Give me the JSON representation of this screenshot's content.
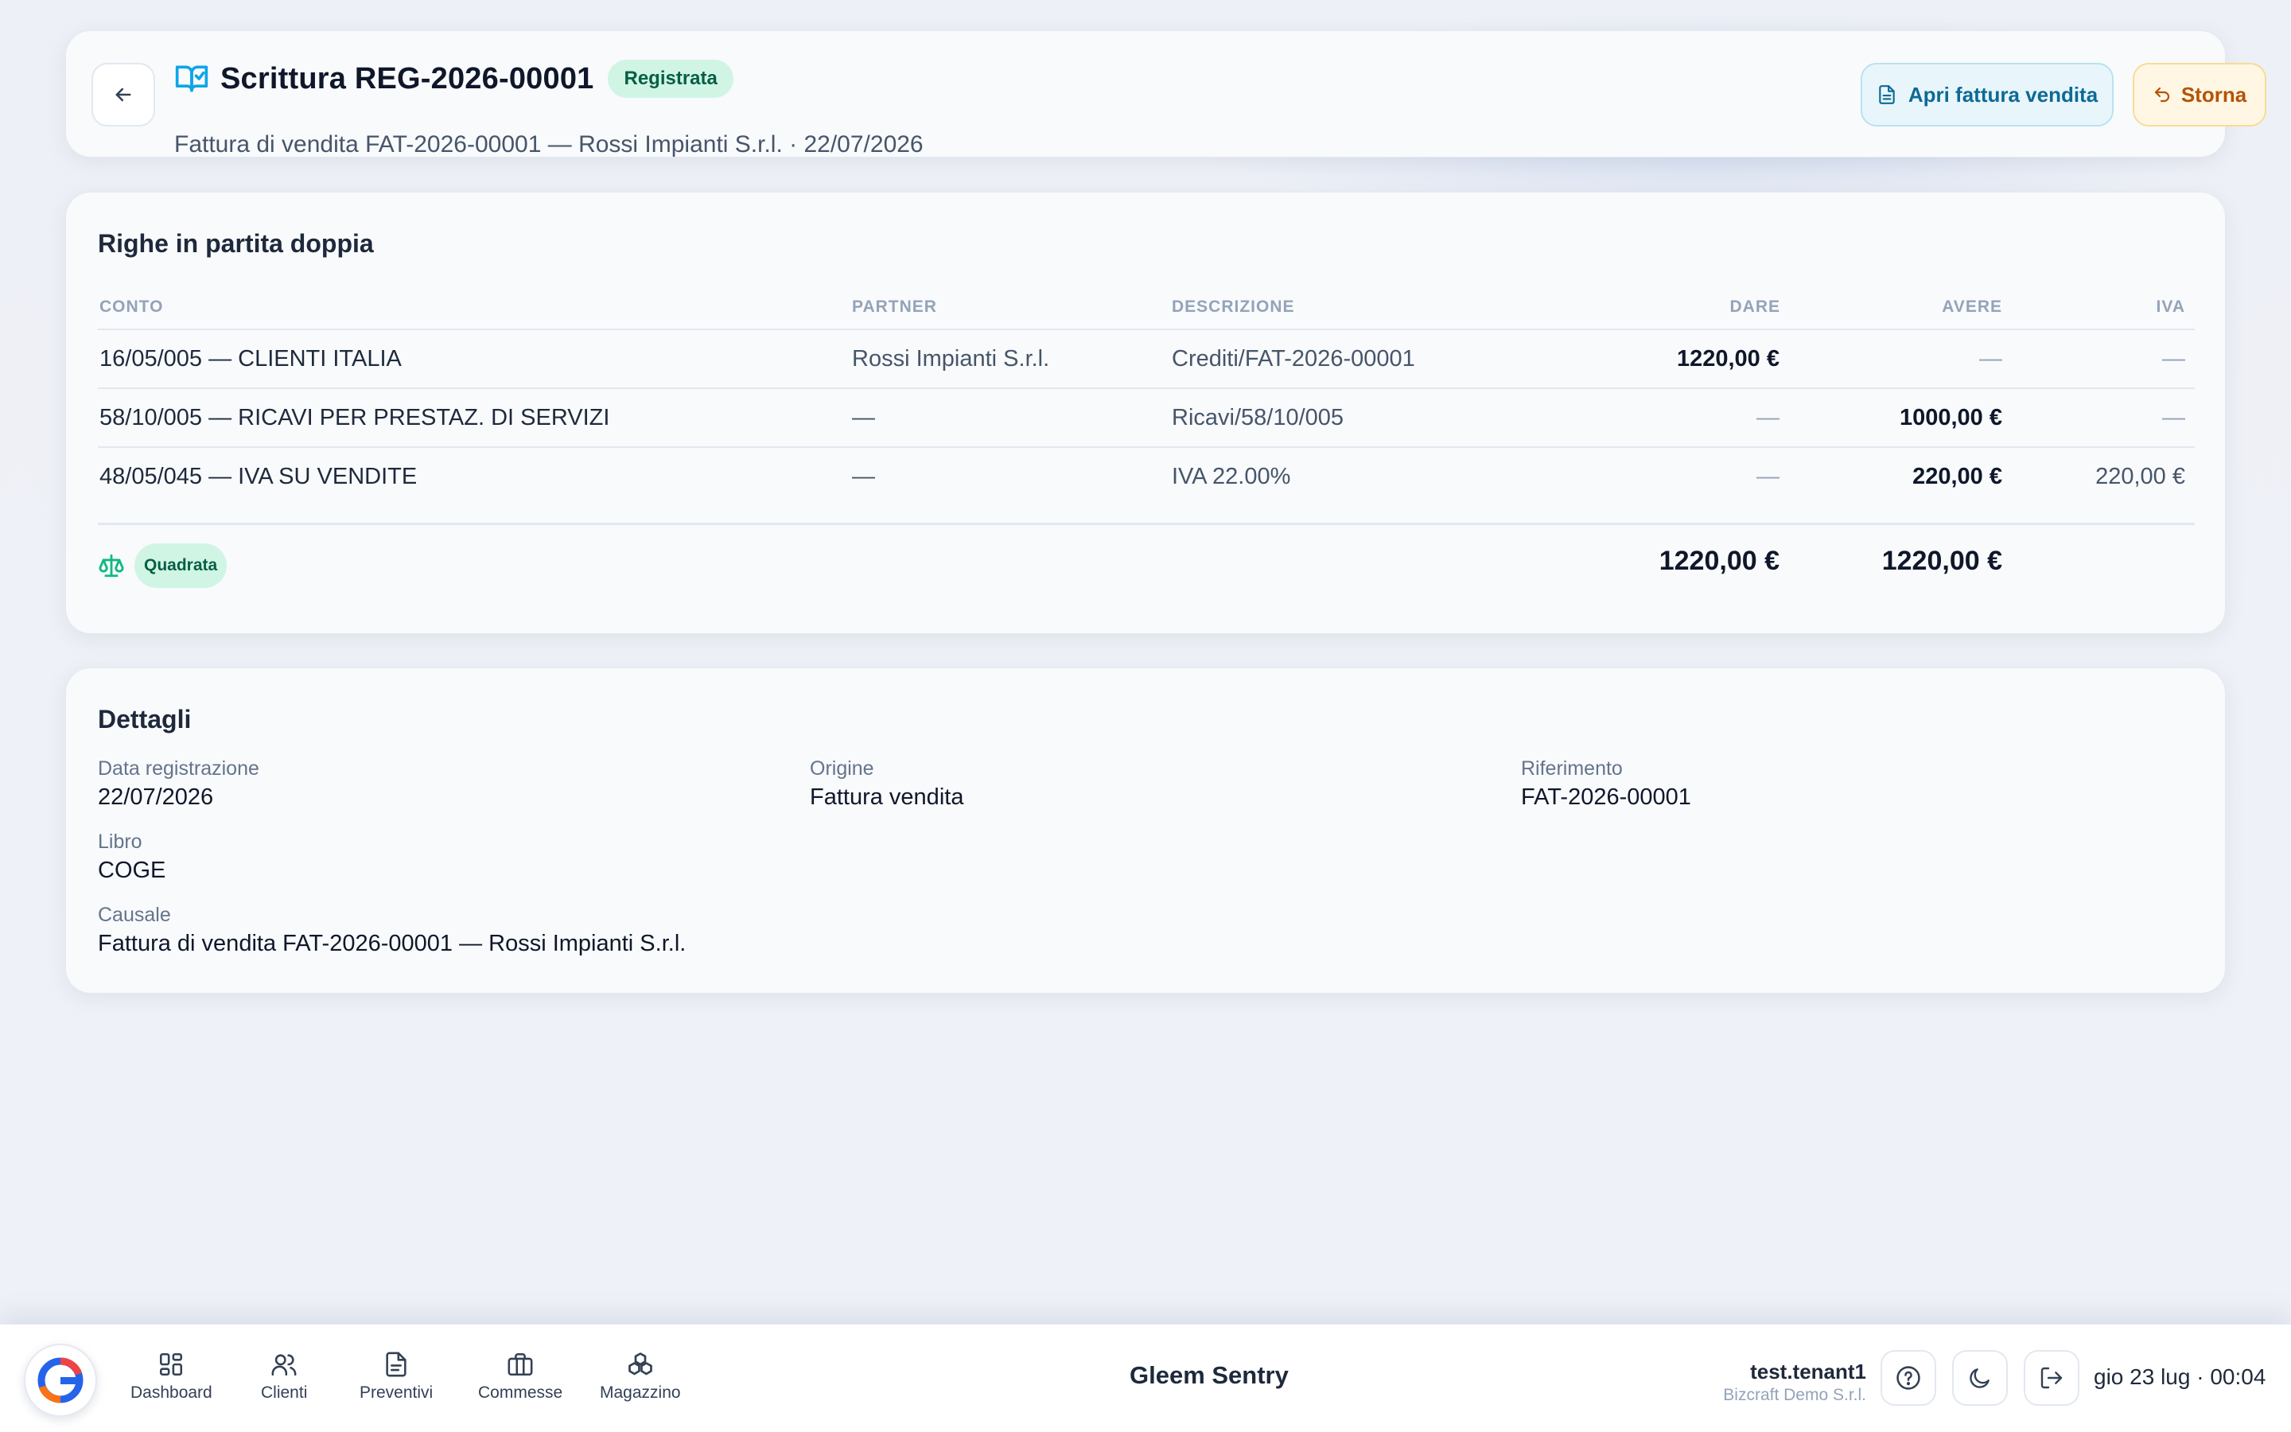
{
  "header": {
    "title": "Scrittura REG-2026-00001",
    "status_badge": "Registrata",
    "subtitle": "Fattura di vendita FAT-2026-00001 — Rossi Impianti S.r.l. · 22/07/2026",
    "btn_open_invoice": "Apri fattura vendita",
    "btn_storna": "Storna",
    "icons": {
      "back": "arrow-left-icon",
      "title": "book-check-icon",
      "open_invoice": "file-text-icon",
      "storna": "undo-icon"
    }
  },
  "lines": {
    "section_title": "Righe in partita doppia",
    "columns": [
      "CONTO",
      "PARTNER",
      "DESCRIZIONE",
      "DARE",
      "AVERE",
      "IVA"
    ],
    "rows": [
      {
        "conto": "16/05/005 — CLIENTI ITALIA",
        "partner": "Rossi Impianti S.r.l.",
        "descrizione": "Crediti/FAT-2026-00001",
        "dare": "1220,00 €",
        "avere": "—",
        "iva": "—"
      },
      {
        "conto": "58/10/005 — RICAVI PER PRESTAZ. DI SERVIZI",
        "partner": "—",
        "descrizione": "Ricavi/58/10/005",
        "dare": "—",
        "avere": "1000,00 €",
        "iva": "—"
      },
      {
        "conto": "48/05/045 — IVA SU VENDITE",
        "partner": "—",
        "descrizione": "IVA 22.00%",
        "dare": "—",
        "avere": "220,00 €",
        "iva": "220,00 €"
      }
    ],
    "balance_badge": "Quadrata",
    "total_dare": "1220,00 €",
    "total_avere": "1220,00 €"
  },
  "details": {
    "section_title": "Dettagli",
    "data_registrazione_label": "Data registrazione",
    "data_registrazione": "22/07/2026",
    "origine_label": "Origine",
    "origine": "Fattura vendita",
    "riferimento_label": "Riferimento",
    "riferimento": "FAT-2026-00001",
    "libro_label": "Libro",
    "libro": "COGE",
    "causale_label": "Causale",
    "causale": "Fattura di vendita FAT-2026-00001 — Rossi Impianti S.r.l."
  },
  "bottom_bar": {
    "nav": [
      {
        "label": "Dashboard",
        "icon": "grid-icon"
      },
      {
        "label": "Clienti",
        "icon": "users-icon"
      },
      {
        "label": "Preventivi",
        "icon": "file-icon"
      },
      {
        "label": "Commesse",
        "icon": "briefcase-icon"
      },
      {
        "label": "Magazzino",
        "icon": "boxes-icon"
      }
    ],
    "brand": "Gleem Sentry",
    "user_name": "test.tenant1",
    "user_org": "Bizcraft Demo S.r.l.",
    "clock": "gio 23 lug · 00:04"
  },
  "colors": {
    "accent": "#0ea5e9",
    "success_bg": "#d1f5e4",
    "success_text": "#065f46",
    "warning_text": "#b45309"
  }
}
